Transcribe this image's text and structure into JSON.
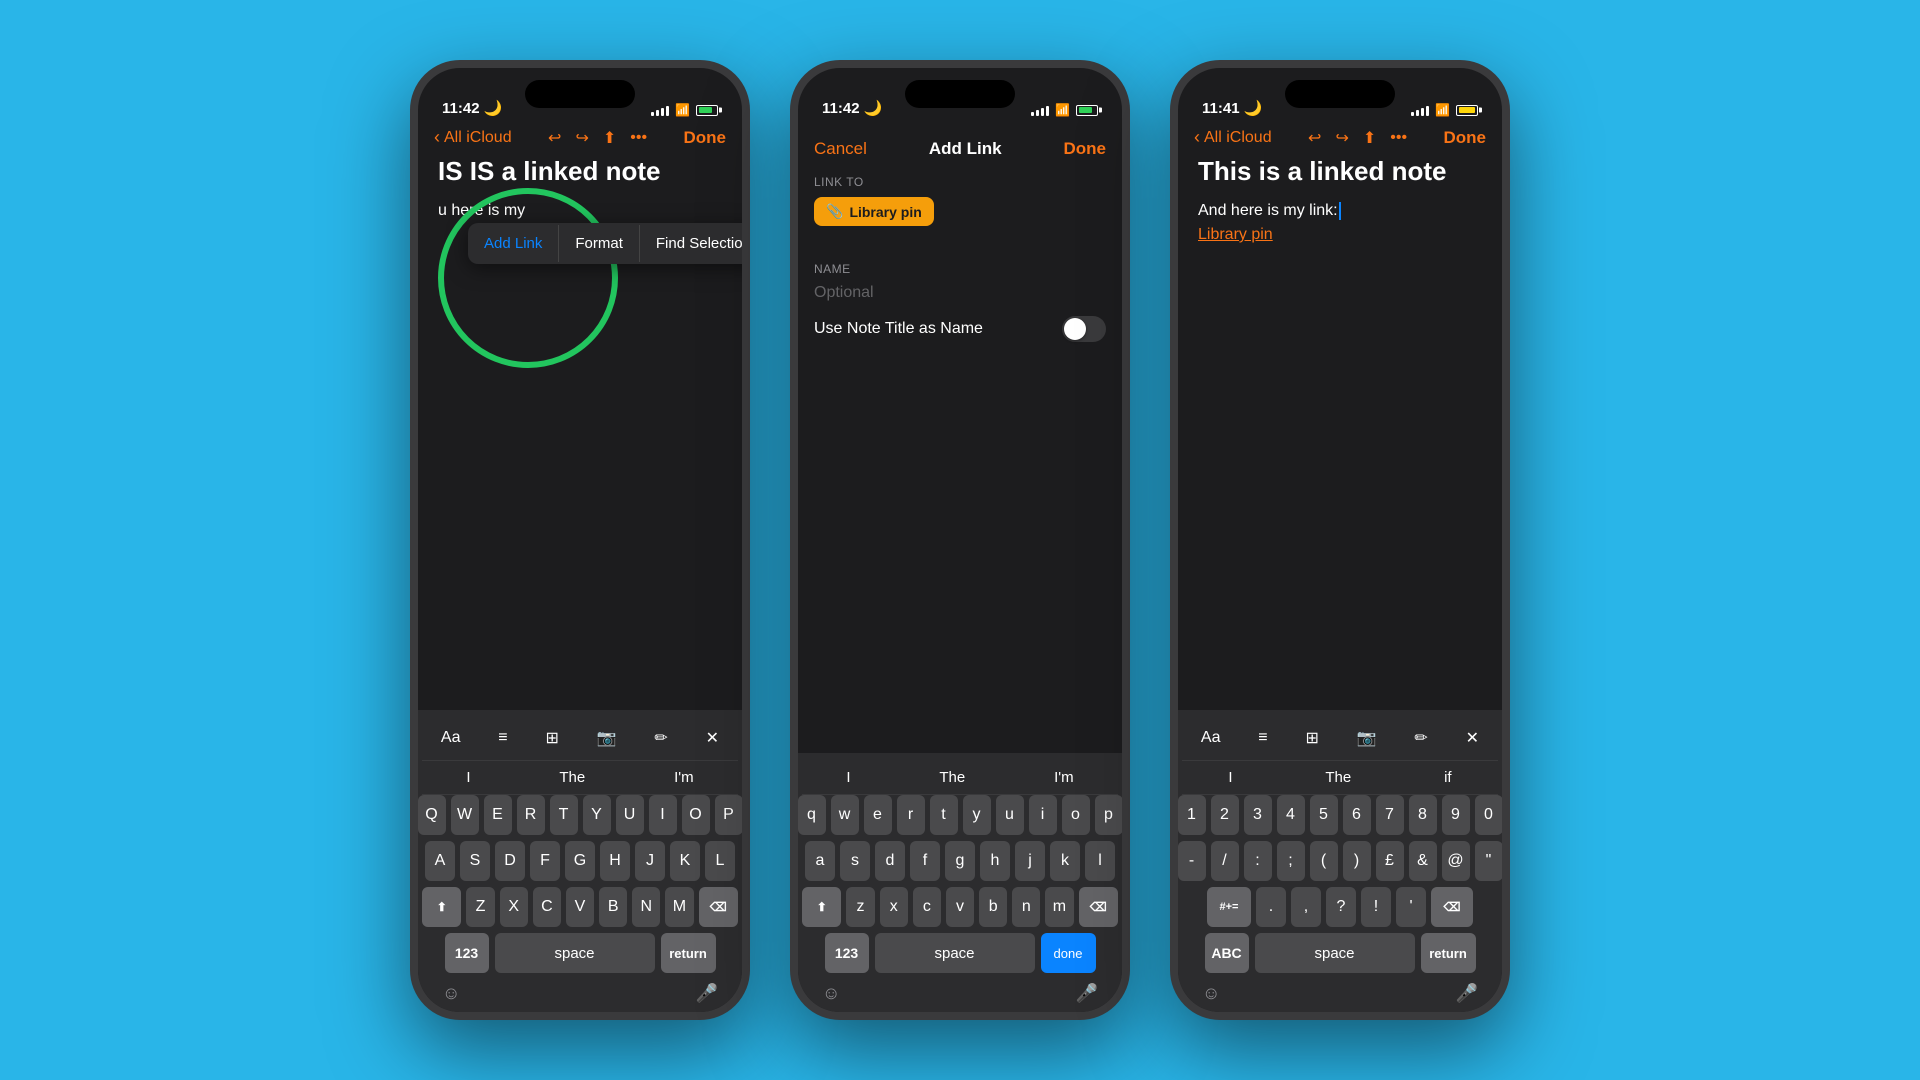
{
  "background": "#29b5e8",
  "phones": [
    {
      "id": "phone1",
      "statusBar": {
        "time": "11:42",
        "moonIcon": "🌙",
        "signal": ".....",
        "wifi": "wifi",
        "battery": "99+",
        "batteryColor": "green"
      },
      "nav": {
        "back": "All iCloud",
        "icons": [
          "undo",
          "redo",
          "share",
          "more"
        ],
        "done": "Done"
      },
      "title": "IS IS a linked note",
      "contextMenu": {
        "items": [
          "Add Link",
          "Format",
          "Find Selection"
        ]
      },
      "keyboard": {
        "tools": [
          "Aa",
          "list",
          "table",
          "camera",
          "pencil",
          "close"
        ],
        "suggestions": [
          "I",
          "The",
          "I'm"
        ],
        "rows": [
          [
            "Q",
            "W",
            "E",
            "R",
            "T",
            "Y",
            "U",
            "I",
            "O",
            "P"
          ],
          [
            "A",
            "S",
            "D",
            "F",
            "G",
            "H",
            "J",
            "K",
            "L"
          ],
          [
            "Z",
            "X",
            "C",
            "V",
            "B",
            "N",
            "M"
          ],
          [
            "123",
            "space",
            "return"
          ]
        ]
      }
    },
    {
      "id": "phone2",
      "statusBar": {
        "time": "11:42",
        "moonIcon": "🌙",
        "signal": ".....",
        "wifi": "wifi",
        "battery": "98%",
        "batteryColor": "green"
      },
      "dialog": {
        "cancel": "Cancel",
        "title": "Add Link",
        "done": "Done",
        "linkToLabel": "LINK TO",
        "linkTag": "Library pin",
        "nameLabel": "NAME",
        "namePlaceholder": "Optional",
        "toggleLabel": "Use Note Title as Name",
        "toggleOn": false
      },
      "keyboard": {
        "suggestions": [
          "I",
          "The",
          "I'm"
        ],
        "rows": [
          [
            "q",
            "w",
            "e",
            "r",
            "t",
            "y",
            "u",
            "i",
            "o",
            "p"
          ],
          [
            "a",
            "s",
            "d",
            "f",
            "g",
            "h",
            "j",
            "k",
            "l"
          ],
          [
            "z",
            "x",
            "c",
            "v",
            "b",
            "n",
            "m"
          ],
          [
            "123",
            "space",
            "done"
          ]
        ]
      }
    },
    {
      "id": "phone3",
      "statusBar": {
        "time": "11:41",
        "moonIcon": "🌙",
        "signal": ".....",
        "wifi": "wifi",
        "battery": "98+",
        "batteryColor": "yellow"
      },
      "nav": {
        "back": "All iCloud",
        "icons": [
          "undo",
          "redo",
          "share",
          "more"
        ],
        "done": "Done"
      },
      "title": "This is a linked note",
      "body": "And here is my link:",
      "link": "Library pin",
      "keyboard": {
        "tools": [
          "Aa",
          "list",
          "table",
          "camera",
          "pencil",
          "close"
        ],
        "suggestions": [
          "I",
          "The",
          "if"
        ],
        "rows": [
          [
            "1",
            "2",
            "3",
            "4",
            "5",
            "6",
            "7",
            "8",
            "9",
            "0"
          ],
          [
            "-",
            "/",
            ":",
            ";",
            "(",
            ")",
            "£",
            "&",
            "@",
            "\""
          ],
          [
            "#+=",
            ".",
            ",",
            "?",
            "!",
            "'",
            "⌫"
          ],
          [
            "ABC",
            "space",
            "return"
          ]
        ],
        "isSymbol": true
      }
    }
  ]
}
